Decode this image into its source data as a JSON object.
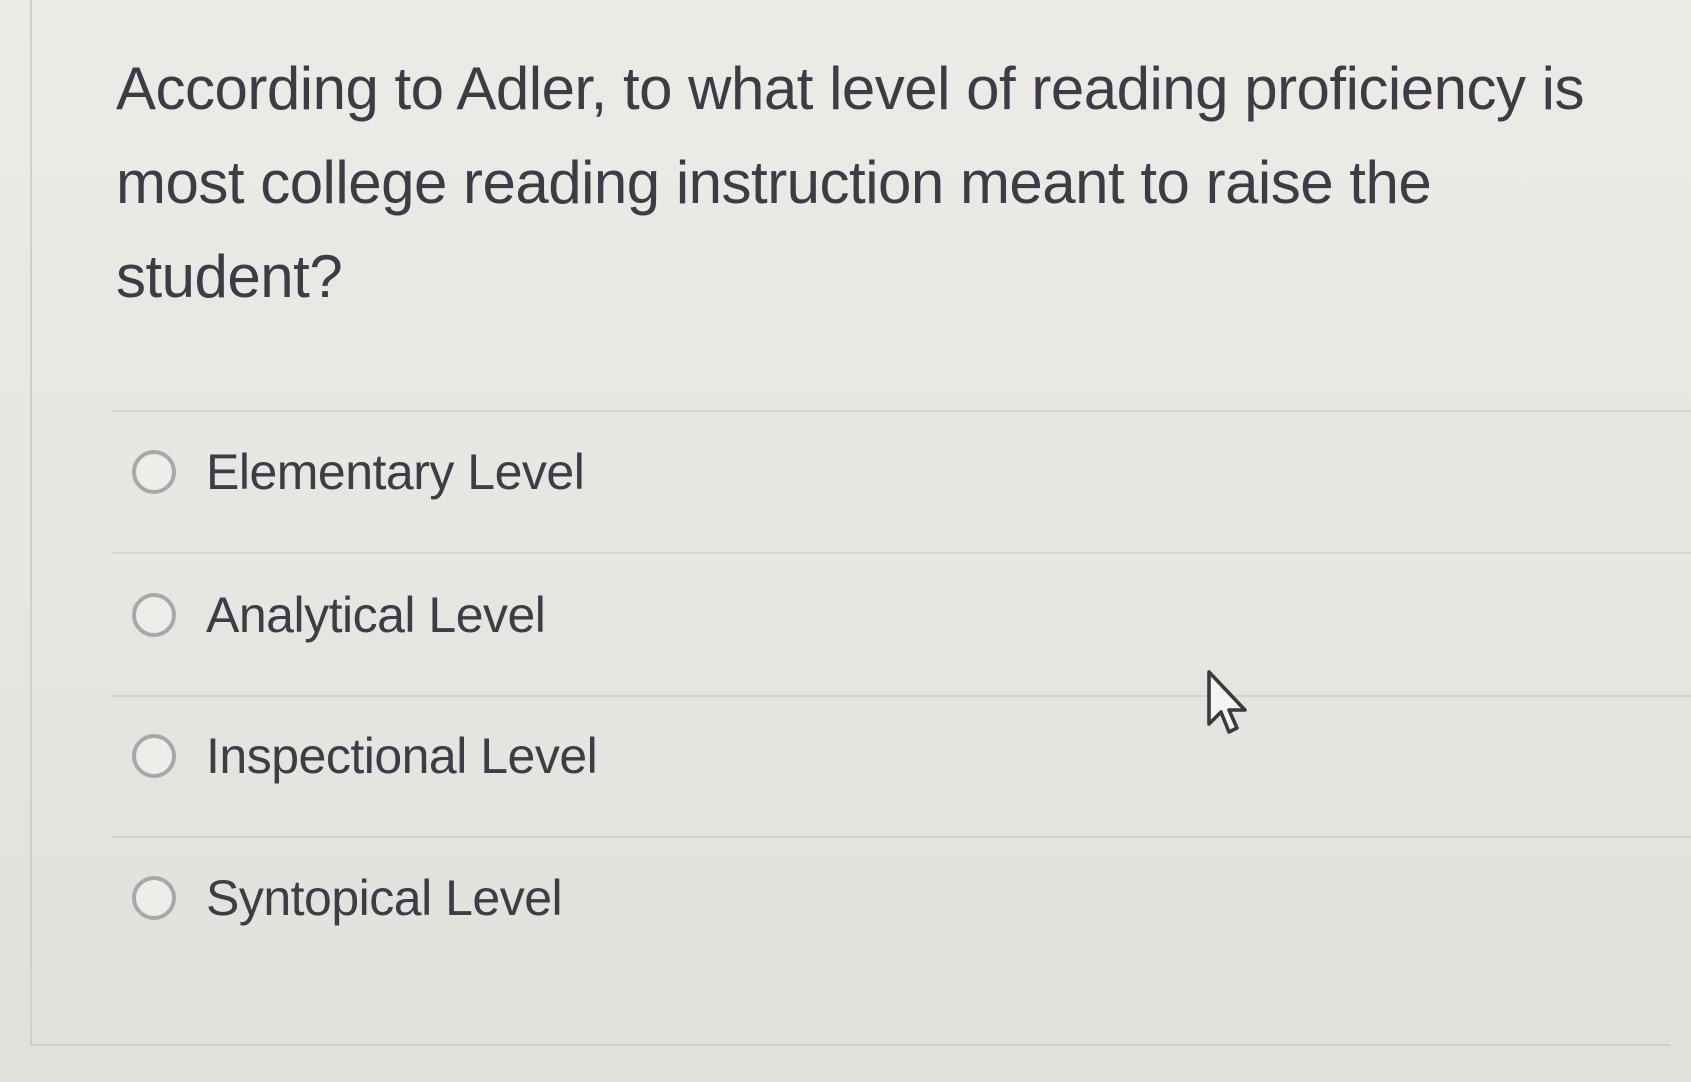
{
  "question": {
    "text": "According to Adler, to what level of reading proficiency is most college reading instruction meant to raise the student?"
  },
  "answers": [
    {
      "label": "Elementary Level",
      "selected": false
    },
    {
      "label": "Analytical Level",
      "selected": false
    },
    {
      "label": "Inspectional Level",
      "selected": false
    },
    {
      "label": "Syntopical Level",
      "selected": false
    }
  ],
  "icons": {
    "cursor": "mouse-pointer-icon"
  },
  "colors": {
    "text": "#3c3c44",
    "radio_border": "#a8a8a8",
    "divider": "#d5d4d0",
    "background": "#e7e6e2"
  }
}
